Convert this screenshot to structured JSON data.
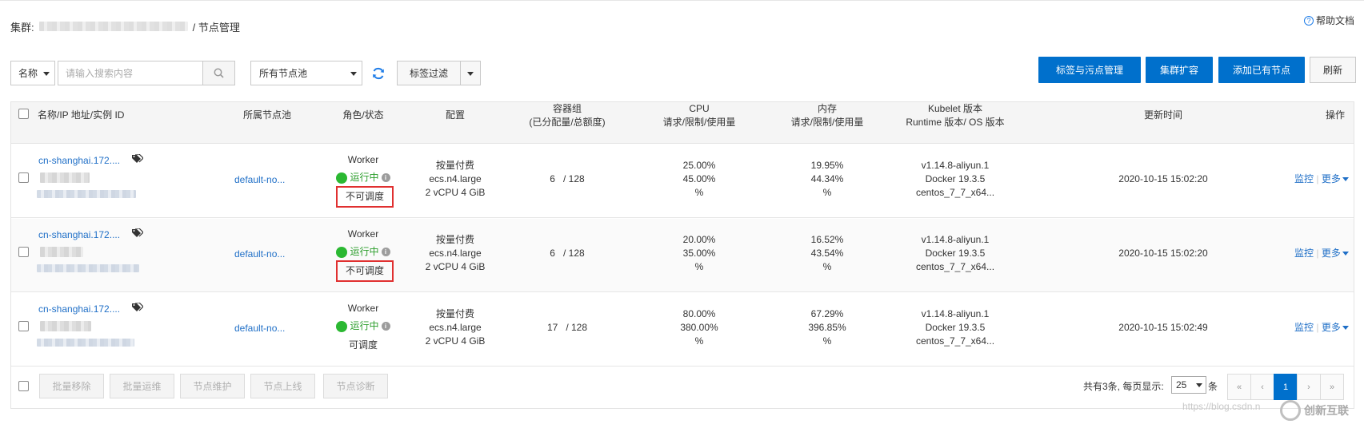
{
  "header": {
    "cluster_label": "集群:",
    "page_title": "/ 节点管理",
    "help": "帮助文档"
  },
  "toolbar": {
    "name_select": "名称",
    "search_placeholder": "请输入搜索内容",
    "pool_select": "所有节点池",
    "tag_filter": "标签过滤",
    "btn_labels_taints": "标签与污点管理",
    "btn_scale": "集群扩容",
    "btn_add_node": "添加已有节点",
    "btn_refresh": "刷新"
  },
  "table": {
    "columns": {
      "name": "名称/IP 地址/实例 ID",
      "pool": "所属节点池",
      "role": "角色/状态",
      "config": "配置",
      "pods_1": "容器组",
      "pods_2": "(已分配量/总额度)",
      "cpu_1": "CPU",
      "cpu_2": "请求/限制/使用量",
      "mem_1": "内存",
      "mem_2": "请求/限制/使用量",
      "kubelet_1": "Kubelet 版本",
      "kubelet_2": "Runtime 版本/ OS 版本",
      "updated": "更新时间",
      "actions": "操作"
    },
    "rows": [
      {
        "name": "cn-shanghai.172....",
        "pool": "default-no...",
        "role": "Worker",
        "status": "运行中",
        "schedulable": "不可调度",
        "billing": "按量付费",
        "instance_type": "ecs.n4.large",
        "spec": "2 vCPU 4 GiB",
        "pods": "6",
        "pods_total": "/ 128",
        "cpu_request": "25.00%",
        "cpu_limit": "45.00%",
        "cpu_usage": "%",
        "mem_request": "19.95%",
        "mem_limit": "44.34%",
        "mem_usage": "%",
        "kubelet": "v1.14.8-aliyun.1",
        "runtime": "Docker 19.3.5",
        "os": "centos_7_7_x64...",
        "updated": "2020-10-15 15:02:20",
        "monitor": "监控",
        "more": "更多"
      },
      {
        "name": "cn-shanghai.172....",
        "pool": "default-no...",
        "role": "Worker",
        "status": "运行中",
        "schedulable": "不可调度",
        "billing": "按量付费",
        "instance_type": "ecs.n4.large",
        "spec": "2 vCPU 4 GiB",
        "pods": "6",
        "pods_total": "/ 128",
        "cpu_request": "20.00%",
        "cpu_limit": "35.00%",
        "cpu_usage": "%",
        "mem_request": "16.52%",
        "mem_limit": "43.54%",
        "mem_usage": "%",
        "kubelet": "v1.14.8-aliyun.1",
        "runtime": "Docker 19.3.5",
        "os": "centos_7_7_x64...",
        "updated": "2020-10-15 15:02:20",
        "monitor": "监控",
        "more": "更多"
      },
      {
        "name": "cn-shanghai.172....",
        "pool": "default-no...",
        "role": "Worker",
        "status": "运行中",
        "schedulable": "可调度",
        "billing": "按量付费",
        "instance_type": "ecs.n4.large",
        "spec": "2 vCPU 4 GiB",
        "pods": "17",
        "pods_total": "/ 128",
        "cpu_request": "80.00%",
        "cpu_limit": "380.00%",
        "cpu_usage": "%",
        "mem_request": "67.29%",
        "mem_limit": "396.85%",
        "mem_usage": "%",
        "kubelet": "v1.14.8-aliyun.1",
        "runtime": "Docker 19.3.5",
        "os": "centos_7_7_x64...",
        "updated": "2020-10-15 15:02:49",
        "monitor": "监控",
        "more": "更多"
      }
    ]
  },
  "footer": {
    "btn_batch_remove": "批量移除",
    "btn_batch_ops": "批量运维",
    "btn_maintain": "节点维护",
    "btn_online": "节点上线",
    "btn_diagnose": "节点诊断",
    "total_text": "共有3条, 每页显示:",
    "page_size": "25",
    "page_size_suffix": "条",
    "pager": {
      "first": "«",
      "prev": "‹",
      "current": "1",
      "next": "›",
      "last": "»"
    }
  },
  "watermark": {
    "url": "https://blog.csdn.n",
    "brand": "创新互联"
  },
  "colors": {
    "primary": "#0070cc",
    "link": "#1f6fc7",
    "running": "#2bb832",
    "highlight_box": "#e03030"
  }
}
